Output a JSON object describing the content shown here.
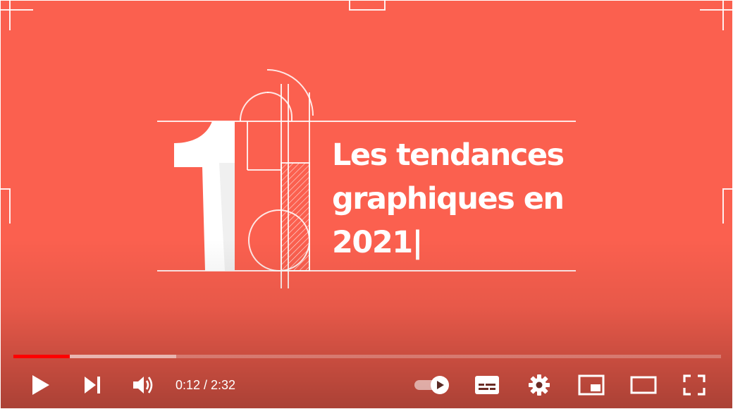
{
  "video": {
    "title_lines": [
      "Les tendances",
      "graphiques en",
      "2021|"
    ],
    "big_number": "1",
    "background_color": "#fb604f"
  },
  "progress": {
    "played_fraction": 0.08,
    "buffered_fraction": 0.23,
    "played_color": "#ff0000"
  },
  "controls": {
    "time_display": "0:12 / 2:32",
    "icons": [
      "play-icon",
      "next-icon",
      "volume-icon",
      "autoplay-toggle-icon",
      "subtitles-icon",
      "settings-icon",
      "miniplayer-icon",
      "theater-mode-icon",
      "fullscreen-icon"
    ]
  }
}
